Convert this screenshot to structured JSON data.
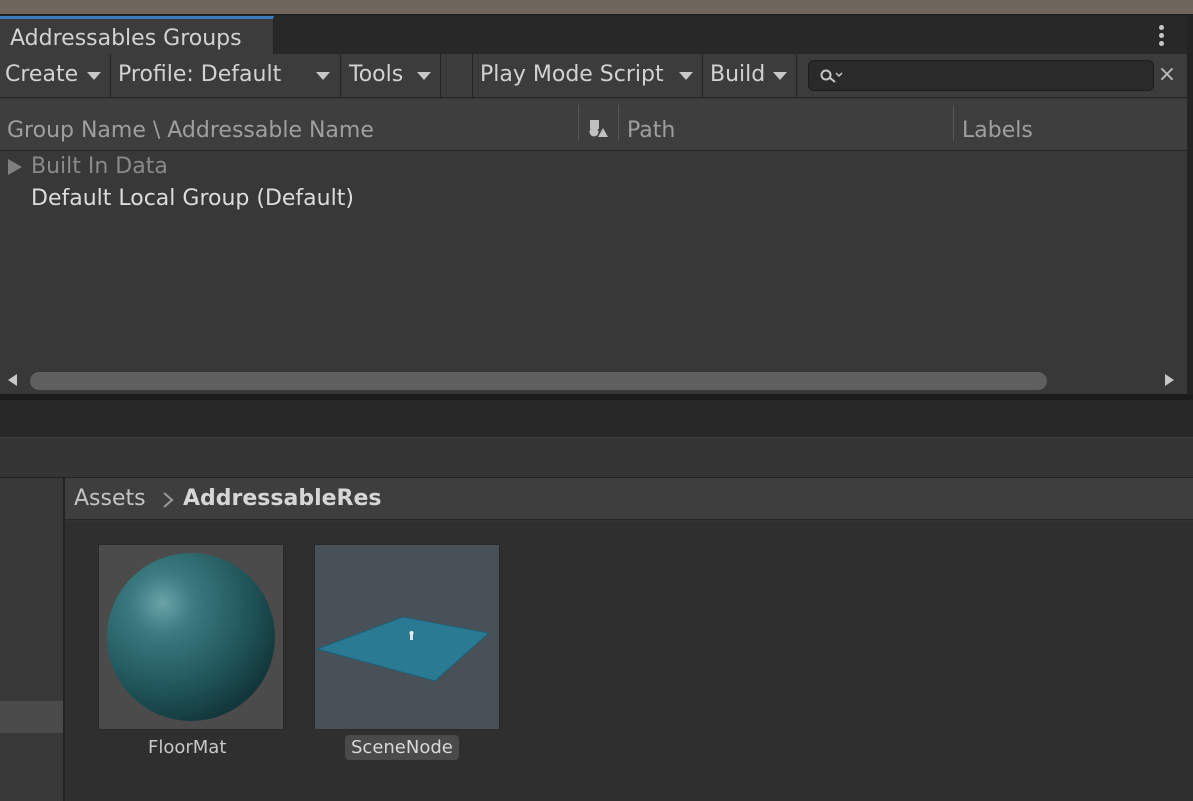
{
  "window": {
    "tab_title": "Addressables Groups"
  },
  "toolbar": {
    "create_label": "Create",
    "profile_label": "Profile: Default",
    "tools_label": "Tools",
    "play_mode_label": "Play Mode Script",
    "build_label": "Build",
    "search_placeholder": "",
    "clear_symbol": "×"
  },
  "columns": {
    "group_name": "Group Name \\ Addressable Name",
    "path": "Path",
    "labels": "Labels"
  },
  "groups": [
    {
      "name": "Built In Data",
      "expandable": true,
      "dimmed": true
    },
    {
      "name": "Default Local Group (Default)",
      "expandable": false,
      "dimmed": false
    }
  ],
  "scrollbar": {
    "visible_fraction": 0.9
  },
  "project": {
    "breadcrumb": {
      "root": "Assets",
      "current": "AddressableRes"
    },
    "assets": [
      {
        "name": "FloorMat",
        "kind": "material",
        "selected": false,
        "color": "#2f6a6e"
      },
      {
        "name": "SceneNode",
        "kind": "prefab",
        "selected": true,
        "color": "#2a7a94"
      }
    ]
  },
  "theme": {
    "accent": "#3a79bb",
    "panel_bg": "#383838"
  }
}
